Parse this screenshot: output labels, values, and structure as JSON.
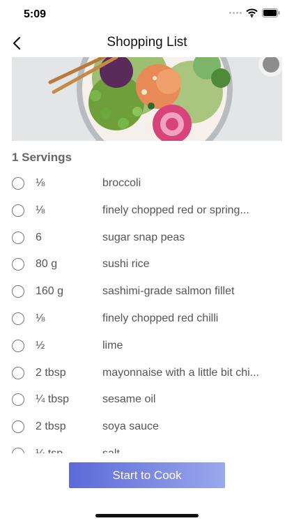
{
  "status": {
    "time": "5:09"
  },
  "nav": {
    "title": "Shopping List"
  },
  "servings_label": "1 Servings",
  "ingredients": [
    {
      "qty": "⅛",
      "name": "broccoli"
    },
    {
      "qty": "⅛",
      "name": "finely chopped red or spring..."
    },
    {
      "qty": "6",
      "name": "sugar snap peas"
    },
    {
      "qty": "80 g",
      "name": "sushi rice"
    },
    {
      "qty": "160 g",
      "name": "sashimi-grade salmon fillet"
    },
    {
      "qty": "⅛",
      "name": "finely chopped red chilli"
    },
    {
      "qty": "½",
      "name": "lime"
    },
    {
      "qty": "2 tbsp",
      "name": "mayonnaise with a little bit chi..."
    },
    {
      "qty": "¼ tbsp",
      "name": "sesame oil"
    },
    {
      "qty": "2 tbsp",
      "name": "soya sauce"
    },
    {
      "qty": "¼ tsp",
      "name": "salt"
    }
  ],
  "start_button": "Start to Cook",
  "colors": {
    "button_start": "#5b6ad8",
    "button_end": "#9aa8ec",
    "text_muted": "#555555"
  }
}
